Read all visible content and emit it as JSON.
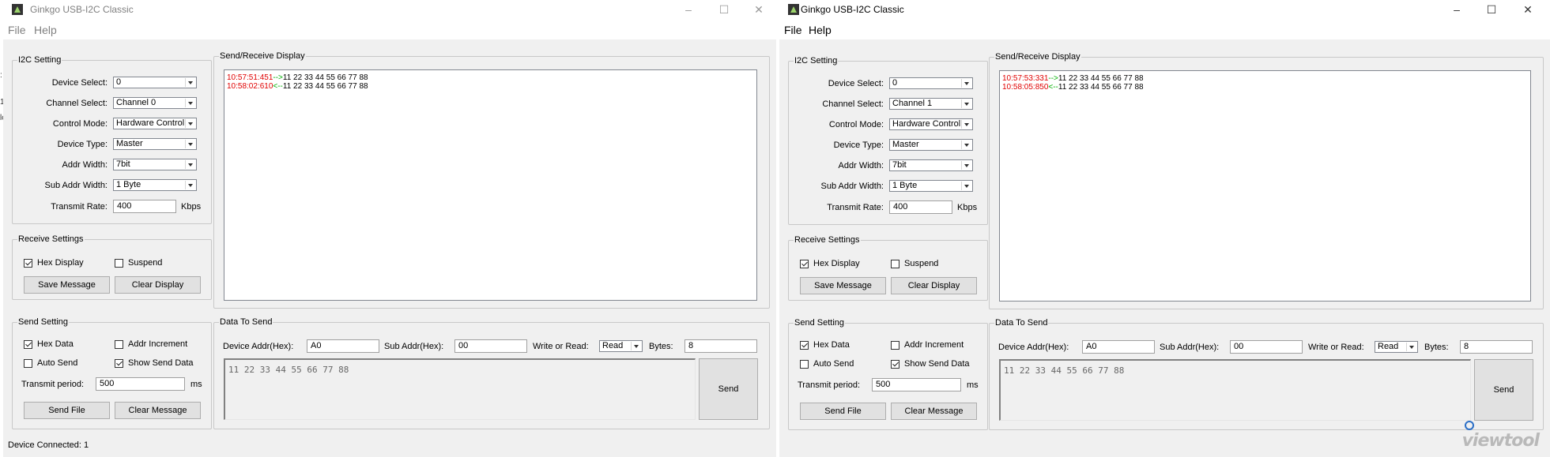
{
  "windows": [
    {
      "title": "Ginkgo USB-I2C Classic",
      "menu": [
        "File",
        "Help"
      ],
      "i2c": {
        "group": "I2C Setting",
        "device_select_label": "Device Select:",
        "device_select": "0",
        "channel_select_label": "Channel Select:",
        "channel_select": "Channel 0",
        "control_mode_label": "Control Mode:",
        "control_mode": "Hardware Control",
        "device_type_label": "Device Type:",
        "device_type": "Master",
        "addr_width_label": "Addr Width:",
        "addr_width": "7bit",
        "sub_addr_width_label": "Sub Addr Width:",
        "sub_addr_width": "1 Byte",
        "transmit_rate_label": "Transmit Rate:",
        "transmit_rate": "400",
        "transmit_rate_unit": "Kbps"
      },
      "receive": {
        "group": "Receive Settings",
        "hex_display": "Hex Display",
        "hex_display_checked": true,
        "suspend": "Suspend",
        "suspend_checked": false,
        "save_message": "Save Message",
        "clear_display": "Clear Display"
      },
      "send_setting": {
        "group": "Send Setting",
        "hex_data": "Hex Data",
        "hex_data_checked": true,
        "addr_increment": "Addr Increment",
        "addr_increment_checked": false,
        "auto_send": "Auto Send",
        "auto_send_checked": false,
        "show_send_data": "Show Send Data",
        "show_send_data_checked": true,
        "transmit_period_label": "Transmit period:",
        "transmit_period": "500",
        "transmit_period_unit": "ms",
        "send_file": "Send File",
        "clear_message": "Clear Message"
      },
      "display": {
        "group": "Send/Receive Display",
        "lines": [
          {
            "time": "10:57:51:451",
            "arrow": "-->",
            "data": "11 22 33 44 55 66 77 88"
          },
          {
            "time": "10:58:02:610",
            "arrow": "<--",
            "data": "11 22 33 44 55 66 77 88"
          }
        ]
      },
      "data_to_send": {
        "group": "Data To Send",
        "device_addr_label": "Device Addr(Hex):",
        "device_addr": "A0",
        "sub_addr_label": "Sub Addr(Hex):",
        "sub_addr": "00",
        "write_read_label": "Write or Read:",
        "write_read": "Read",
        "bytes_label": "Bytes:",
        "bytes": "8",
        "payload": "11 22 33 44 55 66 77 88",
        "send": "Send"
      },
      "status": "Device Connected: 1"
    },
    {
      "title": "Ginkgo USB-I2C Classic",
      "menu": [
        "File",
        "Help"
      ],
      "i2c": {
        "group": "I2C Setting",
        "device_select_label": "Device Select:",
        "device_select": "0",
        "channel_select_label": "Channel Select:",
        "channel_select": "Channel 1",
        "control_mode_label": "Control Mode:",
        "control_mode": "Hardware Control",
        "device_type_label": "Device Type:",
        "device_type": "Master",
        "addr_width_label": "Addr Width:",
        "addr_width": "7bit",
        "sub_addr_width_label": "Sub Addr Width:",
        "sub_addr_width": "1 Byte",
        "transmit_rate_label": "Transmit Rate:",
        "transmit_rate": "400",
        "transmit_rate_unit": "Kbps"
      },
      "receive": {
        "group": "Receive Settings",
        "hex_display": "Hex Display",
        "hex_display_checked": true,
        "suspend": "Suspend",
        "suspend_checked": false,
        "save_message": "Save Message",
        "clear_display": "Clear Display"
      },
      "send_setting": {
        "group": "Send Setting",
        "hex_data": "Hex Data",
        "hex_data_checked": true,
        "addr_increment": "Addr Increment",
        "addr_increment_checked": false,
        "auto_send": "Auto Send",
        "auto_send_checked": false,
        "show_send_data": "Show Send Data",
        "show_send_data_checked": true,
        "transmit_period_label": "Transmit period:",
        "transmit_period": "500",
        "transmit_period_unit": "ms",
        "send_file": "Send File",
        "clear_message": "Clear Message"
      },
      "display": {
        "group": "Send/Receive Display",
        "lines": [
          {
            "time": "10:57:53:331",
            "arrow": "-->",
            "data": "11 22 33 44 55 66 77 88"
          },
          {
            "time": "10:58:05:850",
            "arrow": "<--",
            "data": "11 22 33 44 55 66 77 88"
          }
        ]
      },
      "data_to_send": {
        "group": "Data To Send",
        "device_addr_label": "Device Addr(Hex):",
        "device_addr": "A0",
        "sub_addr_label": "Sub Addr(Hex):",
        "sub_addr": "00",
        "write_read_label": "Write or Read:",
        "write_read": "Read",
        "bytes_label": "Bytes:",
        "bytes": "8",
        "payload": "11 22 33 44 55 66 77 88",
        "send": "Send"
      }
    }
  ],
  "watermark": "viewtool",
  "edge_fragments": [
    ":",
    "1",
    "lo"
  ]
}
